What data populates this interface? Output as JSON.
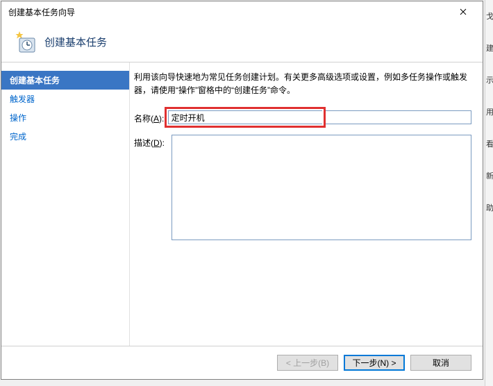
{
  "titlebar": {
    "title": "创建基本任务向导"
  },
  "header": {
    "title": "创建基本任务"
  },
  "sidebar": {
    "items": [
      {
        "label": "创建基本任务",
        "active": true
      },
      {
        "label": "触发器",
        "active": false
      },
      {
        "label": "操作",
        "active": false
      },
      {
        "label": "完成",
        "active": false
      }
    ]
  },
  "content": {
    "intro": "利用该向导快速地为常见任务创建计划。有关更多高级选项或设置，例如多任务操作或触发器，请使用“操作”窗格中的“创建任务”命令。",
    "name_label_prefix": "名称(",
    "name_label_key": "A",
    "name_label_suffix": "):",
    "name_value": "定时开机",
    "desc_label_prefix": "描述(",
    "desc_label_key": "D",
    "desc_label_suffix": "):",
    "desc_value": ""
  },
  "buttons": {
    "back": "< 上一步(B)",
    "next": "下一步(N) >",
    "cancel": "取消"
  },
  "rightStrip": {
    "a": "戈",
    "b": "建",
    "c": "示",
    "d": "用",
    "e": "看",
    "f": "新",
    "g": "助"
  }
}
